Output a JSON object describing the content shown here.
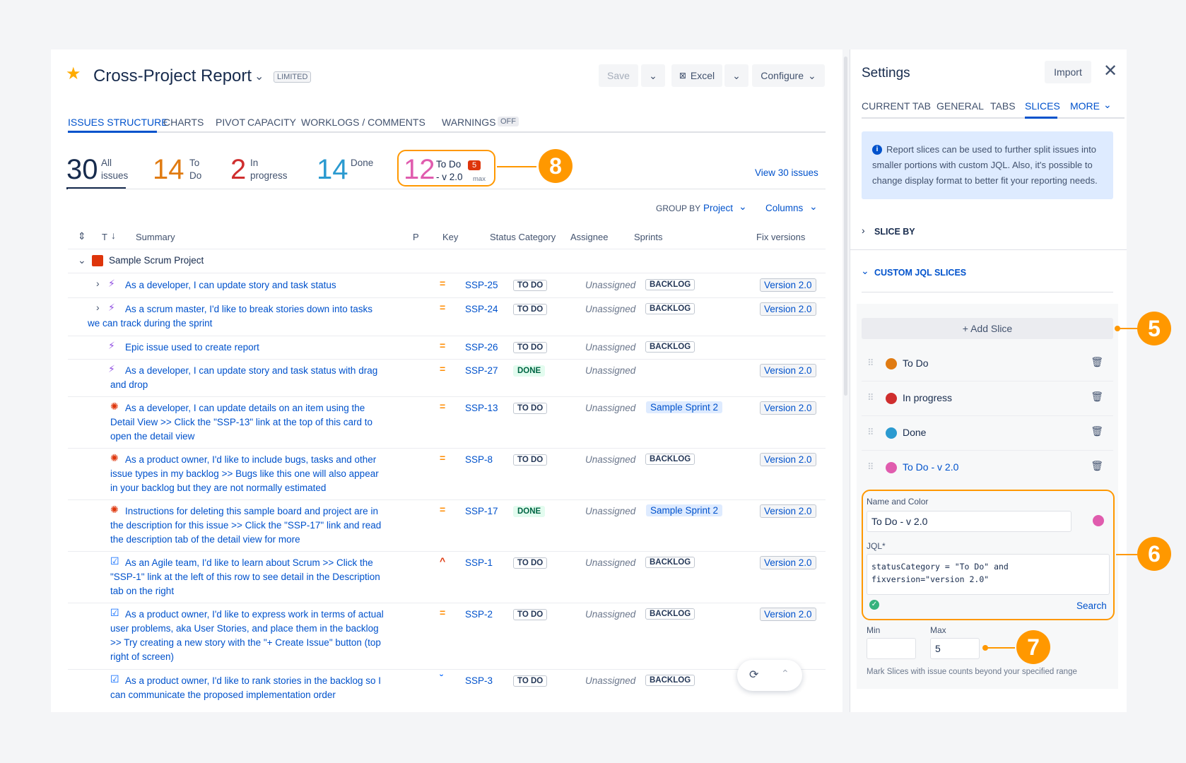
{
  "report": {
    "title": "Cross-Project Report",
    "badge": "LIMITED",
    "save": "Save",
    "excel": "Excel",
    "configure": "Configure"
  },
  "tabs": [
    "ISSUES STRUCTURE",
    "CHARTS",
    "PIVOT",
    "CAPACITY",
    "WORKLOGS / COMMENTS",
    "WARNINGS"
  ],
  "warnings_state": "OFF",
  "stats": {
    "all": {
      "n": "30",
      "l1": "All",
      "l2": "issues"
    },
    "todo": {
      "n": "14",
      "l1": "To",
      "l2": "Do"
    },
    "inprog": {
      "n": "2",
      "l1": "In",
      "l2": "progress"
    },
    "done": {
      "n": "14",
      "l1": "Done"
    },
    "slice": {
      "n": "12",
      "l1": "To Do",
      "l2": "- v 2.0",
      "max_count": "5",
      "max_label": "max"
    },
    "view_link": "View 30 issues"
  },
  "toolbar": {
    "group_by_label": "GROUP BY",
    "group_by_value": "Project",
    "columns": "Columns"
  },
  "columns": {
    "t": "T",
    "summary": "Summary",
    "p": "P",
    "key": "Key",
    "status": "Status Category",
    "assignee": "Assignee",
    "sprints": "Sprints",
    "fix": "Fix versions"
  },
  "group": "Sample Scrum Project",
  "rows": [
    {
      "s1": "As a developer, I can update story and task status",
      "s2": "",
      "s3": "",
      "prio": "=",
      "key": "SSP-25",
      "status": "TO DO",
      "ass": "Unassigned",
      "sprint": "BACKLOG",
      "fix": "Version 2.0"
    },
    {
      "s1": "As a scrum master, I'd like to break stories down into tasks",
      "s2": "we can track during the sprint",
      "s3": "",
      "prio": "=",
      "key": "SSP-24",
      "status": "TO DO",
      "ass": "Unassigned",
      "sprint": "BACKLOG",
      "fix": "Version 2.0"
    },
    {
      "s1": "Epic issue used to create report",
      "s2": "",
      "s3": "",
      "prio": "=",
      "key": "SSP-26",
      "status": "TO DO",
      "ass": "Unassigned",
      "sprint": "BACKLOG",
      "fix": ""
    },
    {
      "s1": "As a developer, I can update story and task status with drag",
      "s2": "and drop",
      "s3": "",
      "prio": "=",
      "key": "SSP-27",
      "status": "DONE",
      "ass": "Unassigned",
      "sprint": "",
      "fix": "Version 2.0"
    },
    {
      "s1": "As a developer, I can update details on an item using the",
      "s2": "Detail View >> Click the \"SSP-13\" link at the top of this card to",
      "s3": "open the detail view",
      "prio": "=",
      "key": "SSP-13",
      "status": "TO DO",
      "ass": "Unassigned",
      "sprint": "Sample Sprint 2",
      "fix": "Version 2.0"
    },
    {
      "s1": "As a product owner, I'd like to include bugs, tasks and other",
      "s2": "issue types in my backlog >> Bugs like this one will also appear",
      "s3": "in your backlog but they are not normally estimated",
      "prio": "=",
      "key": "SSP-8",
      "status": "TO DO",
      "ass": "Unassigned",
      "sprint": "BACKLOG",
      "fix": "Version 2.0"
    },
    {
      "s1": "Instructions for deleting this sample board and project are in",
      "s2": "the description for this issue >> Click the \"SSP-17\" link and read",
      "s3": "the description tab of the detail view for more",
      "prio": "=",
      "key": "SSP-17",
      "status": "DONE",
      "ass": "Unassigned",
      "sprint": "Sample Sprint 2",
      "fix": "Version 2.0"
    },
    {
      "s1": "As an Agile team, I'd like to learn about Scrum >> Click the",
      "s2": "\"SSP-1\" link at the left of this row to see detail in the Description",
      "s3": "tab on the right",
      "prio": "^",
      "key": "SSP-1",
      "status": "TO DO",
      "ass": "Unassigned",
      "sprint": "BACKLOG",
      "fix": "Version 2.0"
    },
    {
      "s1": "As a product owner, I'd like to express work in terms of actual",
      "s2": "user problems, aka User Stories, and place them in the backlog",
      "s3": ">> Try creating a new story with the \"+ Create Issue\" button (top",
      "s4": "right of screen)",
      "prio": "=",
      "key": "SSP-2",
      "status": "TO DO",
      "ass": "Unassigned",
      "sprint": "BACKLOG",
      "fix": "Version 2.0"
    },
    {
      "s1": "As a product owner, I'd like to rank stories in the backlog so I",
      "s2": "can communicate the proposed implementation order",
      "s3": "",
      "prio": "ˇ",
      "key": "SSP-3",
      "status": "TO DO",
      "ass": "Unassigned",
      "sprint": "BACKLOG",
      "fix": ""
    }
  ],
  "settings": {
    "title": "Settings",
    "import": "Import",
    "tabs": [
      "CURRENT TAB",
      "GENERAL",
      "TABS",
      "SLICES",
      "MORE"
    ],
    "info": [
      "Report slices can be used to further split issues into",
      "smaller portions with custom JQL. Also, it's possible to",
      "change display format to better fit your reporting needs."
    ],
    "slice_by": "SLICE BY",
    "custom": "CUSTOM JQL SLICES",
    "add": "+ Add Slice",
    "slices": [
      {
        "name": "To Do",
        "color": "#e07b12"
      },
      {
        "name": "In progress",
        "color": "#cf2e2e"
      },
      {
        "name": "Done",
        "color": "#2b9ad0"
      },
      {
        "name": "To Do - v 2.0",
        "color": "#e05cae"
      }
    ],
    "name_color_label": "Name and Color",
    "name_value": "To Do - v 2.0",
    "jql_label": "JQL*",
    "jql_line1": "statusCategory = \"To Do\" and",
    "jql_line2": "fixversion=\"version 2.0\"",
    "search": "Search",
    "min_label": "Min",
    "max_label": "Max",
    "min_value": "",
    "max_value": "5",
    "hint": "Mark Slices with issue counts beyond your specified range"
  },
  "callouts": [
    "8",
    "5",
    "6",
    "7"
  ],
  "colors": {
    "accent": "#0052cc",
    "callout": "#ff9800",
    "todo": "#e07b12",
    "inprog": "#cf2e2e",
    "done": "#2b9ad0",
    "slice": "#e05cae"
  }
}
